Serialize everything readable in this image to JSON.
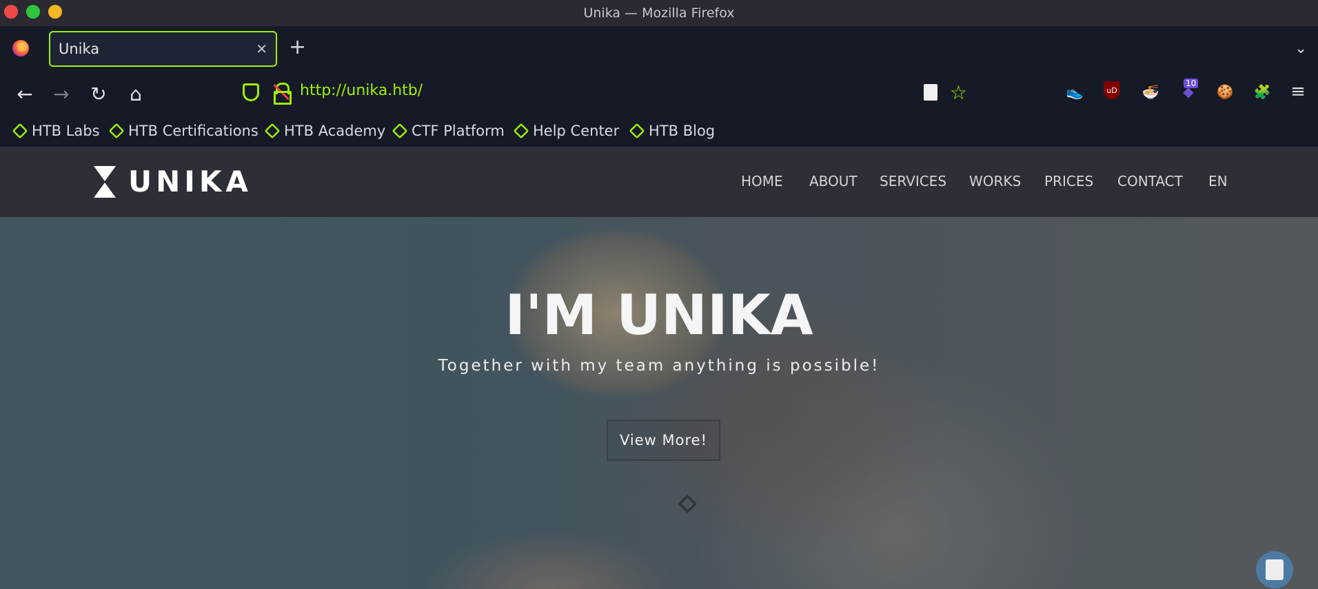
{
  "window": {
    "title": "Unika — Mozilla Firefox"
  },
  "tab": {
    "label": "Unika",
    "close_glyph": "✕"
  },
  "nav": {
    "back": "←",
    "forward": "→",
    "reload": "↻",
    "home": "⌂",
    "url": "http://unika.htb/",
    "tabs_dropdown": "⌄",
    "menu": "≡",
    "extension_badge": "10"
  },
  "bookmarks": [
    "HTB Labs",
    "HTB Certifications",
    "HTB Academy",
    "CTF Platform",
    "Help Center",
    "HTB Blog"
  ],
  "site": {
    "logo": "UNIKA",
    "menu": [
      "HOME",
      "ABOUT",
      "SERVICES",
      "WORKS",
      "PRICES",
      "CONTACT",
      "EN"
    ],
    "hero": {
      "title": "I'M UNIKA",
      "subtitle": "Together with my team anything is possible!",
      "button": "View More!"
    }
  },
  "colors": {
    "accent": "#9fef00",
    "toolbar_bg": "#161a26",
    "site_header_bg": "#2c3036"
  }
}
